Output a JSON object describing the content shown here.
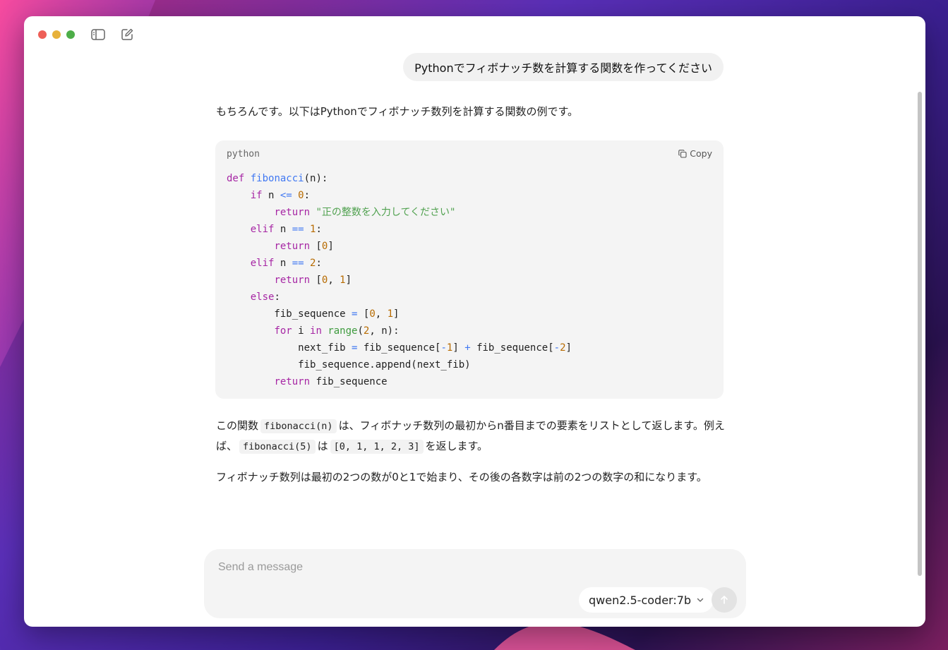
{
  "titlebar": {
    "icons": [
      "close-dot",
      "minimize-dot",
      "maximize-dot",
      "sidebar-toggle-icon",
      "new-chat-icon"
    ]
  },
  "user_message": "Pythonでフィボナッチ数を計算する関数を作ってください",
  "assistant": {
    "intro": "もちろんです。以下はPythonでフィボナッチ数列を計算する関数の例です。",
    "code_language": "python",
    "copy_label": "Copy",
    "code": [
      "def fibonacci(n):",
      "    if n <= 0:",
      "        return \"正の整数を入力してください\"",
      "    elif n == 1:",
      "        return [0]",
      "    elif n == 2:",
      "        return [0, 1]",
      "    else:",
      "        fib_sequence = [0, 1]",
      "        for i in range(2, n):",
      "            next_fib = fib_sequence[-1] + fib_sequence[-2]",
      "            fib_sequence.append(next_fib)",
      "        return fib_sequence"
    ],
    "para1": {
      "t1": "この関数",
      "c1": "fibonacci(n)",
      "t2": "は、フィボナッチ数列の最初からn番目までの要素をリストとして返します。例えば、",
      "c2": "fibonacci(5)",
      "t3": "は",
      "c3": "[0, 1, 1, 2, 3]",
      "t4": "を返します。"
    },
    "para2": "フィボナッチ数列は最初の2つの数が0と1で始まり、その後の各数字は前の2つの数字の和になります。"
  },
  "composer": {
    "placeholder": "Send a message",
    "value": "",
    "model": "qwen2.5-coder:7b"
  },
  "colors": {
    "keyword": "#a626a4",
    "function": "#4078f2",
    "number": "#b76b01",
    "string": "#50a14f"
  }
}
